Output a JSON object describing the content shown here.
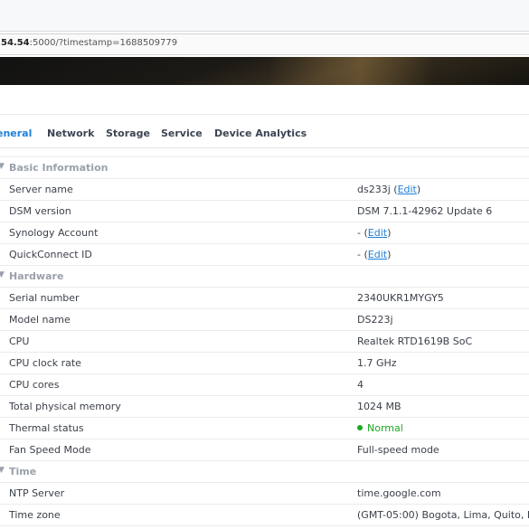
{
  "browser": {
    "url_host": "54.54",
    "url_rest": ":5000/?timestamp=1688509779"
  },
  "tabs": [
    {
      "label": "eneral",
      "active": true
    },
    {
      "label": "Network",
      "active": false
    },
    {
      "label": "Storage",
      "active": false
    },
    {
      "label": "Service",
      "active": false
    },
    {
      "label": "Device Analytics",
      "active": false
    }
  ],
  "groups": {
    "basic": "Basic Information",
    "hardware": "Hardware",
    "time": "Time"
  },
  "rows": {
    "server_name": {
      "key": "Server name",
      "value": "ds233j"
    },
    "dsm_version": {
      "key": "DSM version",
      "value": "DSM 7.1.1-42962 Update 6"
    },
    "synology_account": {
      "key": "Synology Account",
      "value": "-"
    },
    "quickconnect": {
      "key": "QuickConnect ID",
      "value": "-"
    },
    "serial": {
      "key": "Serial number",
      "value": "2340UKR1MYGY5"
    },
    "model": {
      "key": "Model name",
      "value": "DS223j"
    },
    "cpu": {
      "key": "CPU",
      "value": "Realtek RTD1619B SoC"
    },
    "cpu_clock": {
      "key": "CPU clock rate",
      "value": "1.7 GHz"
    },
    "cpu_cores": {
      "key": "CPU cores",
      "value": "4"
    },
    "memory": {
      "key": "Total physical memory",
      "value": "1024 MB"
    },
    "thermal": {
      "key": "Thermal status",
      "value": "Normal"
    },
    "fan": {
      "key": "Fan Speed Mode",
      "value": "Full-speed mode"
    },
    "ntp": {
      "key": "NTP Server",
      "value": "time.google.com"
    },
    "timezone": {
      "key": "Time zone",
      "value": "(GMT-05:00) Bogota, Lima, Quito, R"
    }
  },
  "edit_label": "Edit",
  "colors": {
    "accent": "#1d7fd8",
    "status_ok": "#1aa81f"
  }
}
